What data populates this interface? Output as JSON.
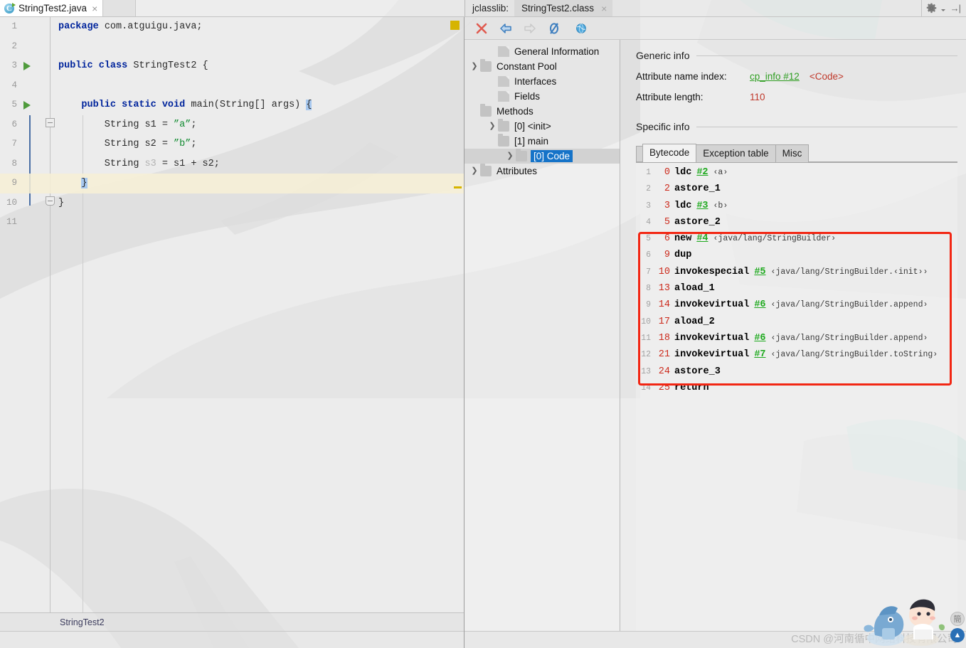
{
  "editor": {
    "tab": {
      "filename": "StringTest2.java",
      "icon": "java-class-icon",
      "close": "×"
    },
    "status_text": "StringTest2",
    "lines": [
      {
        "num": "1",
        "runnable": false,
        "current": false,
        "tokens": [
          {
            "t": "package ",
            "c": "kw"
          },
          {
            "t": "com.atguigu.java;",
            "c": "plain"
          }
        ]
      },
      {
        "num": "2",
        "runnable": false,
        "current": false,
        "tokens": []
      },
      {
        "num": "3",
        "runnable": true,
        "current": false,
        "tokens": [
          {
            "t": "public class ",
            "c": "kw"
          },
          {
            "t": "StringTest2 {",
            "c": "plain"
          }
        ]
      },
      {
        "num": "4",
        "runnable": false,
        "current": false,
        "tokens": []
      },
      {
        "num": "5",
        "runnable": true,
        "current": false,
        "tokens": [
          {
            "t": "    public static void ",
            "c": "kw"
          },
          {
            "t": "main(String[] args) ",
            "c": "plain"
          },
          {
            "t": "{",
            "c": "sel"
          }
        ]
      },
      {
        "num": "6",
        "runnable": false,
        "current": false,
        "tokens": [
          {
            "t": "        String s1 = ",
            "c": "plain"
          },
          {
            "t": "”a”",
            "c": "str"
          },
          {
            "t": ";",
            "c": "plain"
          }
        ]
      },
      {
        "num": "7",
        "runnable": false,
        "current": false,
        "tokens": [
          {
            "t": "        String s2 = ",
            "c": "plain"
          },
          {
            "t": "”b”",
            "c": "str"
          },
          {
            "t": ";",
            "c": "plain"
          }
        ]
      },
      {
        "num": "8",
        "runnable": false,
        "current": false,
        "tokens": [
          {
            "t": "        String ",
            "c": "plain"
          },
          {
            "t": "s3",
            "c": "dim"
          },
          {
            "t": " = s1 + s2;",
            "c": "plain"
          }
        ]
      },
      {
        "num": "9",
        "runnable": false,
        "current": true,
        "tokens": [
          {
            "t": "    ",
            "c": "plain"
          },
          {
            "t": "}",
            "c": "sel"
          }
        ]
      },
      {
        "num": "10",
        "runnable": false,
        "current": false,
        "tokens": [
          {
            "t": "}",
            "c": "plain"
          }
        ]
      },
      {
        "num": "11",
        "runnable": false,
        "current": false,
        "tokens": []
      }
    ]
  },
  "jclasslib": {
    "panel_label": "jclasslib:",
    "tab_title": "StringTest2.class",
    "tab_close": "×",
    "window_buttons": {
      "settings": "gear-icon",
      "hide": "hide-panel-icon"
    },
    "toolbar": [
      {
        "name": "close-button",
        "glyph": "✕",
        "color": "#e05a4f",
        "enabled": true
      },
      {
        "name": "back-button",
        "glyph": "⇦",
        "color": "#3d7ebf",
        "enabled": true
      },
      {
        "name": "forward-button",
        "glyph": "⇨",
        "color": "#c6c6c6",
        "enabled": false
      },
      {
        "name": "reload-button",
        "glyph": "Ø",
        "color": "#3d7ebf",
        "enabled": true
      },
      {
        "name": "browse-button",
        "glyph": "●",
        "color": "#49a6dc",
        "enabled": true
      }
    ],
    "tree": [
      {
        "label": "General Information",
        "icon": "file-icon",
        "twisty": "",
        "indent": 1,
        "selected": false
      },
      {
        "label": "Constant Pool",
        "icon": "folder-icon",
        "twisty": "❯",
        "indent": 0,
        "selected": false
      },
      {
        "label": "Interfaces",
        "icon": "file-icon",
        "twisty": "",
        "indent": 1,
        "selected": false
      },
      {
        "label": "Fields",
        "icon": "file-icon",
        "twisty": "",
        "indent": 1,
        "selected": false
      },
      {
        "label": "Methods",
        "icon": "folder-icon",
        "twisty": "ⱟ",
        "indent": 0,
        "selected": false
      },
      {
        "label": "[0] <init>",
        "icon": "folder-icon",
        "twisty": "❯",
        "indent": 1,
        "selected": false
      },
      {
        "label": "[1] main",
        "icon": "folder-icon",
        "twisty": "ⱟ",
        "indent": 1,
        "selected": false
      },
      {
        "label": "[0] Code",
        "icon": "folder-icon",
        "twisty": "❯",
        "indent": 2,
        "selected": true
      },
      {
        "label": "Attributes",
        "icon": "folder-icon",
        "twisty": "❯",
        "indent": 0,
        "selected": false
      }
    ],
    "generic_info": {
      "heading": "Generic info",
      "attr_name_index_label": "Attribute name index:",
      "attr_name_index_link": "cp_info #12",
      "attr_name_index_value": "<Code>",
      "attr_length_label": "Attribute length:",
      "attr_length_value": "110"
    },
    "specific_info": {
      "heading": "Specific info",
      "tabs": [
        {
          "label": "Bytecode",
          "active": true
        },
        {
          "label": "Exception table",
          "active": false
        },
        {
          "label": "Misc",
          "active": false
        }
      ]
    },
    "bytecode": [
      {
        "idx": "1",
        "offset": "0",
        "op": "ldc",
        "ref": "#2",
        "comment": "‹a›"
      },
      {
        "idx": "2",
        "offset": "2",
        "op": "astore_1",
        "ref": "",
        "comment": ""
      },
      {
        "idx": "3",
        "offset": "3",
        "op": "ldc",
        "ref": "#3",
        "comment": "‹b›"
      },
      {
        "idx": "4",
        "offset": "5",
        "op": "astore_2",
        "ref": "",
        "comment": ""
      },
      {
        "idx": "5",
        "offset": "6",
        "op": "new",
        "ref": "#4",
        "comment": "‹java/lang/StringBuilder›"
      },
      {
        "idx": "6",
        "offset": "9",
        "op": "dup",
        "ref": "",
        "comment": ""
      },
      {
        "idx": "7",
        "offset": "10",
        "op": "invokespecial",
        "ref": "#5",
        "comment": "‹java/lang/StringBuilder.‹init››"
      },
      {
        "idx": "8",
        "offset": "13",
        "op": "aload_1",
        "ref": "",
        "comment": ""
      },
      {
        "idx": "9",
        "offset": "14",
        "op": "invokevirtual",
        "ref": "#6",
        "comment": "‹java/lang/StringBuilder.append›"
      },
      {
        "idx": "10",
        "offset": "17",
        "op": "aload_2",
        "ref": "",
        "comment": ""
      },
      {
        "idx": "11",
        "offset": "18",
        "op": "invokevirtual",
        "ref": "#6",
        "comment": "‹java/lang/StringBuilder.append›"
      },
      {
        "idx": "12",
        "offset": "21",
        "op": "invokevirtual",
        "ref": "#7",
        "comment": "‹java/lang/StringBuilder.toString›"
      },
      {
        "idx": "13",
        "offset": "24",
        "op": "astore_3",
        "ref": "",
        "comment": ""
      },
      {
        "idx": "14",
        "offset": "25",
        "op": "return",
        "ref": "",
        "comment": ""
      }
    ],
    "highlight": {
      "from_index": 5,
      "to_index": 13,
      "color": "#f22613"
    }
  },
  "watermark": {
    "text": "CSDN @河南循中网络科技有限公司"
  },
  "colors": {
    "keyword": "#00249c",
    "string": "#0f8a2f",
    "bytecode_offset": "#cc2b1d",
    "bytecode_ref": "#1faa1f",
    "link_green": "#2f9e22",
    "value_red": "#c0392b",
    "selection_blue": "#1573c8",
    "highlight_red": "#f22613",
    "current_line": "#f7f0d6"
  }
}
